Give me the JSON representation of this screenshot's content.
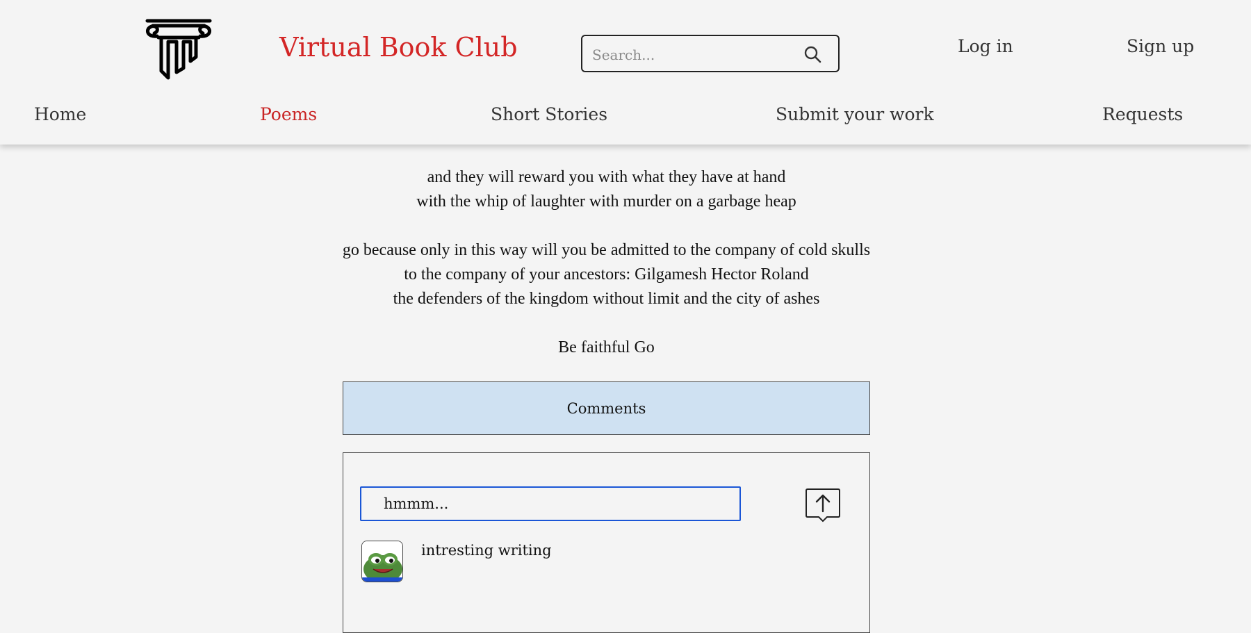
{
  "header": {
    "site_title": "Virtual Book Club",
    "search": {
      "placeholder": "Search...",
      "value": ""
    },
    "login_label": "Log in",
    "signup_label": "Sign up"
  },
  "nav": {
    "items": [
      {
        "label": "Home",
        "active": false
      },
      {
        "label": "Poems",
        "active": true
      },
      {
        "label": "Short Stories",
        "active": false
      },
      {
        "label": "Submit your work",
        "active": false
      },
      {
        "label": "Requests",
        "active": false
      }
    ]
  },
  "poem": {
    "lines": [
      "and they will reward you with what they have at hand",
      "with the whip of laughter with murder on a garbage heap",
      "go because only in this way will you be admitted to the company of cold skulls",
      "to the company of your ancestors: Gilgamesh Hector Roland",
      "the defenders of the kingdom without limit and the city of ashes",
      "Be faithful Go"
    ]
  },
  "comments": {
    "header_label": "Comments",
    "input_value": "hmmm...",
    "items": [
      {
        "avatar_icon": "frog-avatar-icon",
        "text": "intresting writing"
      }
    ]
  },
  "colors": {
    "accent_red": "#d32626",
    "comments_header_bg": "#cfe1f2",
    "input_focus_border": "#1a56d6",
    "page_bg": "#f4f4f4"
  }
}
